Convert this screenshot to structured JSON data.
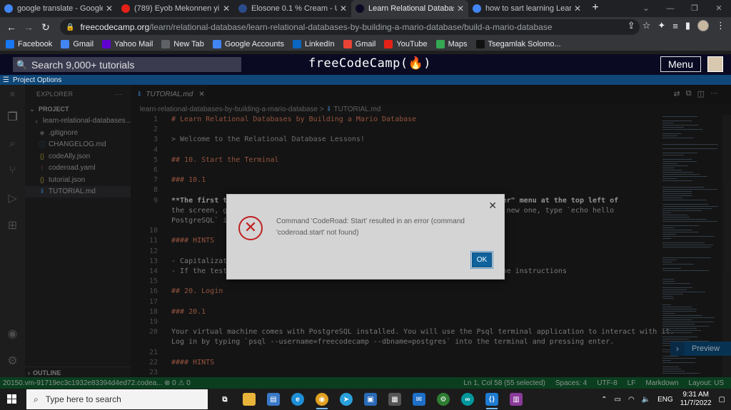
{
  "browser": {
    "tabs": [
      {
        "title": "google translate - Google Se",
        "favicon": "google-icon",
        "color": "#4285f4"
      },
      {
        "title": "(789) Eyob Mekonnen yi",
        "favicon": "youtube-icon",
        "color": "#e62117"
      },
      {
        "title": "Elosone 0.1 % Cream - Uses,",
        "favicon": "p-icon",
        "color": "#2b4c8c"
      },
      {
        "title": "Learn Relational Databases B",
        "favicon": "fcc-icon",
        "color": "#0a0a23"
      },
      {
        "title": "how to sart learning Learn",
        "favicon": "google-icon",
        "color": "#4285f4"
      }
    ],
    "url_host": "freecodecamp.org",
    "url_path": "/learn/relational-database/learn-relational-databases-by-building-a-mario-database/build-a-mario-database",
    "bookmarks": [
      {
        "label": "Facebook",
        "icon": "facebook-icon",
        "color": "#1877f2"
      },
      {
        "label": "Gmail",
        "icon": "google-icon",
        "color": "#4285f4"
      },
      {
        "label": "Yahoo Mail",
        "icon": "mail-icon",
        "color": "#5f01d1"
      },
      {
        "label": "New Tab",
        "icon": "chrome-icon",
        "color": "#5f6368"
      },
      {
        "label": "Google Accounts",
        "icon": "google-icon",
        "color": "#4285f4"
      },
      {
        "label": "LinkedIn",
        "icon": "linkedin-icon",
        "color": "#0a66c2"
      },
      {
        "label": "Gmail",
        "icon": "gmail-icon",
        "color": "#ea4335"
      },
      {
        "label": "YouTube",
        "icon": "youtube-icon",
        "color": "#e62117"
      },
      {
        "label": "Maps",
        "icon": "maps-icon",
        "color": "#34a853"
      },
      {
        "label": "Tsegamlak Solomo...",
        "icon": "tiktok-icon",
        "color": "#111111"
      }
    ]
  },
  "fcc": {
    "search_placeholder": "Search 9,000+ tutorials",
    "logo": "freeCodeCamp(🔥)",
    "menu_label": "Menu"
  },
  "project_options": "Project Options",
  "vscode": {
    "explorer_title": "EXPLORER",
    "project_label": "PROJECT",
    "files": [
      {
        "name": "learn-relational-databases...",
        "icon": "chevron-icon",
        "glyph": "›",
        "color": "#aaaaaa",
        "indent": 10
      },
      {
        "name": ".gitignore",
        "icon": "git-icon",
        "glyph": "◆",
        "color": "#6a6a6a",
        "indent": 18
      },
      {
        "name": "CHANGELOG.md",
        "icon": "info-icon",
        "glyph": "ⓘ",
        "color": "#3e7ab0",
        "indent": 18
      },
      {
        "name": "codeAlly.json",
        "icon": "json-icon",
        "glyph": "{}",
        "color": "#b3a040",
        "indent": 18
      },
      {
        "name": "coderoad.yaml",
        "icon": "yaml-icon",
        "glyph": "!",
        "color": "#a04a7a",
        "indent": 18
      },
      {
        "name": "tutorial.json",
        "icon": "json-icon",
        "glyph": "{}",
        "color": "#b3a040",
        "indent": 18
      },
      {
        "name": "TUTORIAL.md",
        "icon": "markdown-icon",
        "glyph": "⬇",
        "color": "#3e7ab0",
        "indent": 18
      }
    ],
    "outline_label": "OUTLINE",
    "active_tab": "TUTORIAL.md",
    "breadcrumb_folder": "learn-relational-databases-by-building-a-mario-database",
    "breadcrumb_sep": ">",
    "breadcrumb_file": "TUTORIAL.md",
    "code_lines": [
      {
        "n": "1",
        "t": "# Learn Relational Databases by Building a Mario Database",
        "k": "h"
      },
      {
        "n": "2",
        "t": "",
        "k": ""
      },
      {
        "n": "3",
        "t": "> Welcome to the Relational Database Lessons!",
        "k": "q"
      },
      {
        "n": "4",
        "t": "",
        "k": ""
      },
      {
        "n": "5",
        "t": "## 10. Start the Terminal",
        "k": "h"
      },
      {
        "n": "6",
        "t": "",
        "k": ""
      },
      {
        "n": "7",
        "t": "### 10.1",
        "k": "h"
      },
      {
        "n": "8",
        "t": "",
        "k": ""
      },
      {
        "n": "9",
        "t": "**The first th                                                       \"hamburger\" menu at the top left of",
        "k": "b"
      },
      {
        "n": "",
        "t": "the screen, go                                                       u open a new one, type `echo hello",
        "k": ""
      },
      {
        "n": "",
        "t": "PostgreSQL` in",
        "k": ""
      },
      {
        "n": "10",
        "t": "",
        "k": ""
      },
      {
        "n": "11",
        "t": "#### HINTS",
        "k": "h"
      },
      {
        "n": "12",
        "t": "",
        "k": ""
      },
      {
        "n": "13",
        "t": "- Capitalizat",
        "k": ""
      },
      {
        "n": "14",
        "t": "- If the test                                                       redoing the instructions",
        "k": ""
      },
      {
        "n": "15",
        "t": "",
        "k": ""
      },
      {
        "n": "16",
        "t": "## 20. Login",
        "k": "h"
      },
      {
        "n": "17",
        "t": "",
        "k": ""
      },
      {
        "n": "18",
        "t": "### 20.1",
        "k": "h"
      },
      {
        "n": "19",
        "t": "",
        "k": ""
      },
      {
        "n": "20",
        "t": "Your virtual machine comes with PostgreSQL installed. You will use the Psql terminal application to interact with it.",
        "k": ""
      },
      {
        "n": "",
        "t": "Log in by typing `psql --username=freecodecamp --dbname=postgres` into the terminal and pressing enter.",
        "k": ""
      },
      {
        "n": "21",
        "t": "",
        "k": ""
      },
      {
        "n": "22",
        "t": "#### HINTS",
        "k": "h"
      },
      {
        "n": "23",
        "t": "",
        "k": ""
      }
    ],
    "preview_label": "Preview",
    "status_left": "20150.vm-91719ec3c1932e83394d4ed72.codea...",
    "status_problems": "⊗ 0 ⚠ 0",
    "status_right": [
      "Ln 1, Col 58 (55 selected)",
      "Spaces: 4",
      "UTF-8",
      "LF",
      "Markdown",
      "Layout: US"
    ]
  },
  "dialog": {
    "message": "Command 'CodeRoad: Start' resulted in an error (command 'coderoad.start' not found)",
    "ok_label": "OK"
  },
  "taskbar": {
    "search_placeholder": "Type here to search",
    "language": "ENG",
    "time": "9:31 AM",
    "date": "11/7/2022"
  }
}
